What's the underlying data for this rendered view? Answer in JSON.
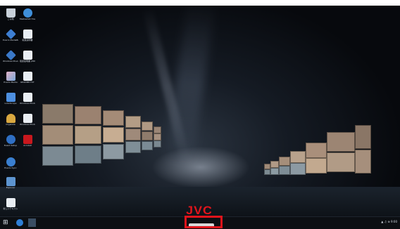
{
  "desktop": {
    "icons": [
      {
        "name": "recycle-bin-icon",
        "label": "ごみ箱"
      },
      {
        "name": "network-icon",
        "label": "Mediashot Host"
      },
      {
        "name": "app-icon-1",
        "label": "Everio MediaBrowser"
      },
      {
        "name": "doc-icon-1",
        "label": "取扱説明書"
      },
      {
        "name": "app-icon-2",
        "label": "Windows Movie"
      },
      {
        "name": "doc-icon-2",
        "label": "取扱説明書 (PDF)"
      },
      {
        "name": "app-icon-3",
        "label": "Everio Media"
      },
      {
        "name": "doc-icon-3",
        "label": "README.TXT"
      },
      {
        "name": "app-icon-4",
        "label": "LoiLoScope"
      },
      {
        "name": "doc-icon-4",
        "label": "Windows Photo"
      },
      {
        "name": "app-icon-5",
        "label": "Organize"
      },
      {
        "name": "doc-icon-5",
        "label": "Windows Photo"
      },
      {
        "name": "app-icon-6",
        "label": "Event Setup"
      },
      {
        "name": "pdf-icon",
        "label": "Acrobat"
      },
      {
        "name": "app-icon-7",
        "label": "Everio Sync"
      },
      {
        "name": "app-icon-8",
        "label": "Explorer"
      },
      {
        "name": "doc-icon-6",
        "label": "新しいテキスト"
      }
    ]
  },
  "brand": {
    "logo_text": "JVC",
    "color": "#e0141b"
  },
  "taskbar": {
    "start_glyph": "⊞",
    "tray_text": "▲ ♫ ⊕ 9:00"
  }
}
